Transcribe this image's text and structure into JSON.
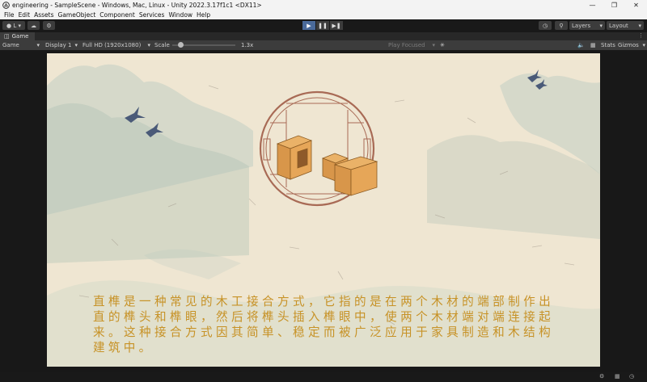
{
  "window": {
    "title": "engineering - SampleScene - Windows, Mac, Linux - Unity 2022.3.17f1c1 <DX11>"
  },
  "menu": [
    "File",
    "Edit",
    "Assets",
    "GameObject",
    "Component",
    "Services",
    "Window",
    "Help"
  ],
  "toolbar": {
    "account_label": "L",
    "layers_label": "Layers",
    "layout_label": "Layout"
  },
  "tab": {
    "label": "Game"
  },
  "gamebar": {
    "mode": "Game",
    "display": "Display 1",
    "resolution": "Full HD (1920x1080)",
    "scale_label": "Scale",
    "scale_value": "1.3x",
    "play_focus": "Play Focused",
    "stats": "Stats",
    "gizmos": "Gizmos"
  },
  "scene": {
    "caption": "直榫是一种常见的木工接合方式，它指的是在两个木材的端部制作出直的榫头和榫眼，然后将榫头插入榫眼中，使两个木材端对端连接起来。这种接合方式因其简单、稳定而被广泛应用于家具制造和木结构建筑中。",
    "text_color": "#c79226",
    "frame_color": "#a86a55"
  }
}
